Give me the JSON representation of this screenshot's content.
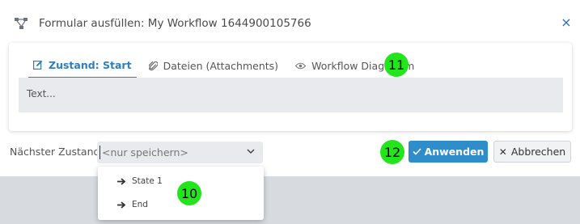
{
  "dialog": {
    "title": "Formular ausfüllen: My Workflow 1644900105766",
    "close_symbol": "×"
  },
  "tabs": [
    {
      "label": "Zustand: Start",
      "icon": "edit-icon",
      "active": true
    },
    {
      "label": "Dateien (Attachments)",
      "icon": "paperclip-icon",
      "active": false
    },
    {
      "label": "Workflow Diagramm",
      "icon": "eye-icon",
      "active": false
    }
  ],
  "textarea": {
    "placeholder": "Text..."
  },
  "footer": {
    "next_state_label": "Nächster Zustand:",
    "select_value": "<nur speichern>",
    "apply_label": "Anwenden",
    "cancel_label": "Abbrechen"
  },
  "dropdown": {
    "options": [
      {
        "label": "State 1",
        "icon": "arrow-right-icon"
      },
      {
        "label": "End",
        "icon": "arrow-right-icon"
      }
    ]
  },
  "badges": {
    "tabs": "11",
    "apply": "12",
    "dropdown": "10"
  },
  "colors": {
    "accent": "#2d7fc0",
    "apply_button": "#2f8dc9",
    "badge": "#22e51b",
    "input_bg": "#e8eaed"
  }
}
